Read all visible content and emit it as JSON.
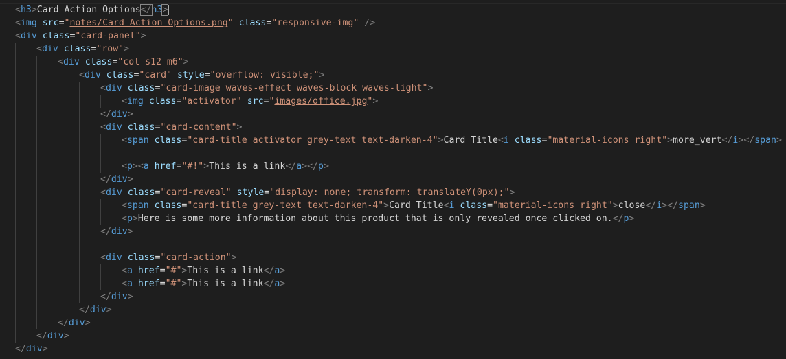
{
  "editor": {
    "lines": [
      {
        "indent": 0,
        "tokens": [
          {
            "c": "p",
            "v": "<"
          },
          {
            "c": "t",
            "v": "h3"
          },
          {
            "c": "p",
            "v": ">"
          },
          {
            "c": "x",
            "v": "Card Action Options"
          },
          {
            "c": "p hl",
            "v": "</"
          },
          {
            "c": "t",
            "v": "h3"
          },
          {
            "c": "p hl",
            "v": ">"
          }
        ]
      },
      {
        "indent": 0,
        "tokens": [
          {
            "c": "p",
            "v": "<"
          },
          {
            "c": "t",
            "v": "img"
          },
          {
            "c": "x",
            "v": " "
          },
          {
            "c": "a",
            "v": "src"
          },
          {
            "c": "x",
            "v": "="
          },
          {
            "c": "s",
            "v": "\""
          },
          {
            "c": "u",
            "v": "notes/Card Action Options.png"
          },
          {
            "c": "s",
            "v": "\""
          },
          {
            "c": "x",
            "v": " "
          },
          {
            "c": "a",
            "v": "class"
          },
          {
            "c": "x",
            "v": "="
          },
          {
            "c": "s",
            "v": "\"responsive-img\""
          },
          {
            "c": "x",
            "v": " "
          },
          {
            "c": "p",
            "v": "/>"
          }
        ]
      },
      {
        "indent": 0,
        "tokens": [
          {
            "c": "p",
            "v": "<"
          },
          {
            "c": "t",
            "v": "div"
          },
          {
            "c": "x",
            "v": " "
          },
          {
            "c": "a",
            "v": "class"
          },
          {
            "c": "x",
            "v": "="
          },
          {
            "c": "s",
            "v": "\"card-panel\""
          },
          {
            "c": "p",
            "v": ">"
          }
        ]
      },
      {
        "indent": 1,
        "tokens": [
          {
            "c": "p",
            "v": "<"
          },
          {
            "c": "t",
            "v": "div"
          },
          {
            "c": "x",
            "v": " "
          },
          {
            "c": "a",
            "v": "class"
          },
          {
            "c": "x",
            "v": "="
          },
          {
            "c": "s",
            "v": "\"row\""
          },
          {
            "c": "p",
            "v": ">"
          }
        ]
      },
      {
        "indent": 2,
        "tokens": [
          {
            "c": "p",
            "v": "<"
          },
          {
            "c": "t",
            "v": "div"
          },
          {
            "c": "x",
            "v": " "
          },
          {
            "c": "a",
            "v": "class"
          },
          {
            "c": "x",
            "v": "="
          },
          {
            "c": "s",
            "v": "\"col s12 m6\""
          },
          {
            "c": "p",
            "v": ">"
          }
        ]
      },
      {
        "indent": 3,
        "tokens": [
          {
            "c": "p",
            "v": "<"
          },
          {
            "c": "t",
            "v": "div"
          },
          {
            "c": "x",
            "v": " "
          },
          {
            "c": "a",
            "v": "class"
          },
          {
            "c": "x",
            "v": "="
          },
          {
            "c": "s",
            "v": "\"card\""
          },
          {
            "c": "x",
            "v": " "
          },
          {
            "c": "a",
            "v": "style"
          },
          {
            "c": "x",
            "v": "="
          },
          {
            "c": "s",
            "v": "\"overflow: visible;\""
          },
          {
            "c": "p",
            "v": ">"
          }
        ]
      },
      {
        "indent": 4,
        "tokens": [
          {
            "c": "p",
            "v": "<"
          },
          {
            "c": "t",
            "v": "div"
          },
          {
            "c": "x",
            "v": " "
          },
          {
            "c": "a",
            "v": "class"
          },
          {
            "c": "x",
            "v": "="
          },
          {
            "c": "s",
            "v": "\"card-image waves-effect waves-block waves-light\""
          },
          {
            "c": "p",
            "v": ">"
          }
        ]
      },
      {
        "indent": 5,
        "tokens": [
          {
            "c": "p",
            "v": "<"
          },
          {
            "c": "t",
            "v": "img"
          },
          {
            "c": "x",
            "v": " "
          },
          {
            "c": "a",
            "v": "class"
          },
          {
            "c": "x",
            "v": "="
          },
          {
            "c": "s",
            "v": "\"activator\""
          },
          {
            "c": "x",
            "v": " "
          },
          {
            "c": "a",
            "v": "src"
          },
          {
            "c": "x",
            "v": "="
          },
          {
            "c": "s",
            "v": "\""
          },
          {
            "c": "u",
            "v": "images/office.jpg"
          },
          {
            "c": "s",
            "v": "\""
          },
          {
            "c": "p",
            "v": ">"
          }
        ]
      },
      {
        "indent": 4,
        "tokens": [
          {
            "c": "p",
            "v": "</"
          },
          {
            "c": "t",
            "v": "div"
          },
          {
            "c": "p",
            "v": ">"
          }
        ]
      },
      {
        "indent": 4,
        "tokens": [
          {
            "c": "p",
            "v": "<"
          },
          {
            "c": "t",
            "v": "div"
          },
          {
            "c": "x",
            "v": " "
          },
          {
            "c": "a",
            "v": "class"
          },
          {
            "c": "x",
            "v": "="
          },
          {
            "c": "s",
            "v": "\"card-content\""
          },
          {
            "c": "p",
            "v": ">"
          }
        ]
      },
      {
        "indent": 5,
        "tokens": [
          {
            "c": "p",
            "v": "<"
          },
          {
            "c": "t",
            "v": "span"
          },
          {
            "c": "x",
            "v": " "
          },
          {
            "c": "a",
            "v": "class"
          },
          {
            "c": "x",
            "v": "="
          },
          {
            "c": "s",
            "v": "\"card-title activator grey-text text-darken-4\""
          },
          {
            "c": "p",
            "v": ">"
          },
          {
            "c": "x",
            "v": "Card Title"
          },
          {
            "c": "p",
            "v": "<"
          },
          {
            "c": "t",
            "v": "i"
          },
          {
            "c": "x",
            "v": " "
          },
          {
            "c": "a",
            "v": "class"
          },
          {
            "c": "x",
            "v": "="
          },
          {
            "c": "s",
            "v": "\"material-icons right\""
          },
          {
            "c": "p",
            "v": ">"
          },
          {
            "c": "x",
            "v": "more_vert"
          },
          {
            "c": "p",
            "v": "</"
          },
          {
            "c": "t",
            "v": "i"
          },
          {
            "c": "p",
            "v": ">"
          },
          {
            "c": "p",
            "v": "</"
          },
          {
            "c": "t",
            "v": "span"
          },
          {
            "c": "p",
            "v": ">"
          }
        ]
      },
      {
        "indent": 5,
        "tokens": []
      },
      {
        "indent": 5,
        "tokens": [
          {
            "c": "p",
            "v": "<"
          },
          {
            "c": "t",
            "v": "p"
          },
          {
            "c": "p",
            "v": ">"
          },
          {
            "c": "p",
            "v": "<"
          },
          {
            "c": "t",
            "v": "a"
          },
          {
            "c": "x",
            "v": " "
          },
          {
            "c": "a",
            "v": "href"
          },
          {
            "c": "x",
            "v": "="
          },
          {
            "c": "s",
            "v": "\"#!\""
          },
          {
            "c": "p",
            "v": ">"
          },
          {
            "c": "x",
            "v": "This is a link"
          },
          {
            "c": "p",
            "v": "</"
          },
          {
            "c": "t",
            "v": "a"
          },
          {
            "c": "p",
            "v": ">"
          },
          {
            "c": "p",
            "v": "</"
          },
          {
            "c": "t",
            "v": "p"
          },
          {
            "c": "p",
            "v": ">"
          }
        ]
      },
      {
        "indent": 4,
        "tokens": [
          {
            "c": "p",
            "v": "</"
          },
          {
            "c": "t",
            "v": "div"
          },
          {
            "c": "p",
            "v": ">"
          }
        ]
      },
      {
        "indent": 4,
        "tokens": [
          {
            "c": "p",
            "v": "<"
          },
          {
            "c": "t",
            "v": "div"
          },
          {
            "c": "x",
            "v": " "
          },
          {
            "c": "a",
            "v": "class"
          },
          {
            "c": "x",
            "v": "="
          },
          {
            "c": "s",
            "v": "\"card-reveal\""
          },
          {
            "c": "x",
            "v": " "
          },
          {
            "c": "a",
            "v": "style"
          },
          {
            "c": "x",
            "v": "="
          },
          {
            "c": "s",
            "v": "\"display: none; transform: translateY(0px);\""
          },
          {
            "c": "p",
            "v": ">"
          }
        ]
      },
      {
        "indent": 5,
        "tokens": [
          {
            "c": "p",
            "v": "<"
          },
          {
            "c": "t",
            "v": "span"
          },
          {
            "c": "x",
            "v": " "
          },
          {
            "c": "a",
            "v": "class"
          },
          {
            "c": "x",
            "v": "="
          },
          {
            "c": "s",
            "v": "\"card-title grey-text text-darken-4\""
          },
          {
            "c": "p",
            "v": ">"
          },
          {
            "c": "x",
            "v": "Card Title"
          },
          {
            "c": "p",
            "v": "<"
          },
          {
            "c": "t",
            "v": "i"
          },
          {
            "c": "x",
            "v": " "
          },
          {
            "c": "a",
            "v": "class"
          },
          {
            "c": "x",
            "v": "="
          },
          {
            "c": "s",
            "v": "\"material-icons right\""
          },
          {
            "c": "p",
            "v": ">"
          },
          {
            "c": "x",
            "v": "close"
          },
          {
            "c": "p",
            "v": "</"
          },
          {
            "c": "t",
            "v": "i"
          },
          {
            "c": "p",
            "v": ">"
          },
          {
            "c": "p",
            "v": "</"
          },
          {
            "c": "t",
            "v": "span"
          },
          {
            "c": "p",
            "v": ">"
          }
        ]
      },
      {
        "indent": 5,
        "tokens": [
          {
            "c": "p",
            "v": "<"
          },
          {
            "c": "t",
            "v": "p"
          },
          {
            "c": "p",
            "v": ">"
          },
          {
            "c": "x",
            "v": "Here is some more information about this product that is only revealed once clicked on."
          },
          {
            "c": "p",
            "v": "</"
          },
          {
            "c": "t",
            "v": "p"
          },
          {
            "c": "p",
            "v": ">"
          }
        ]
      },
      {
        "indent": 4,
        "tokens": [
          {
            "c": "p",
            "v": "</"
          },
          {
            "c": "t",
            "v": "div"
          },
          {
            "c": "p",
            "v": ">"
          }
        ]
      },
      {
        "indent": 4,
        "tokens": []
      },
      {
        "indent": 4,
        "tokens": [
          {
            "c": "p",
            "v": "<"
          },
          {
            "c": "t",
            "v": "div"
          },
          {
            "c": "x",
            "v": " "
          },
          {
            "c": "a",
            "v": "class"
          },
          {
            "c": "x",
            "v": "="
          },
          {
            "c": "s",
            "v": "\"card-action\""
          },
          {
            "c": "p",
            "v": ">"
          }
        ]
      },
      {
        "indent": 5,
        "tokens": [
          {
            "c": "p",
            "v": "<"
          },
          {
            "c": "t",
            "v": "a"
          },
          {
            "c": "x",
            "v": " "
          },
          {
            "c": "a",
            "v": "href"
          },
          {
            "c": "x",
            "v": "="
          },
          {
            "c": "s",
            "v": "\"#\""
          },
          {
            "c": "p",
            "v": ">"
          },
          {
            "c": "x",
            "v": "This is a link"
          },
          {
            "c": "p",
            "v": "</"
          },
          {
            "c": "t",
            "v": "a"
          },
          {
            "c": "p",
            "v": ">"
          }
        ]
      },
      {
        "indent": 5,
        "tokens": [
          {
            "c": "p",
            "v": "<"
          },
          {
            "c": "t",
            "v": "a"
          },
          {
            "c": "x",
            "v": " "
          },
          {
            "c": "a",
            "v": "href"
          },
          {
            "c": "x",
            "v": "="
          },
          {
            "c": "s",
            "v": "\"#\""
          },
          {
            "c": "p",
            "v": ">"
          },
          {
            "c": "x",
            "v": "This is a link"
          },
          {
            "c": "p",
            "v": "</"
          },
          {
            "c": "t",
            "v": "a"
          },
          {
            "c": "p",
            "v": ">"
          }
        ]
      },
      {
        "indent": 4,
        "tokens": [
          {
            "c": "p",
            "v": "</"
          },
          {
            "c": "t",
            "v": "div"
          },
          {
            "c": "p",
            "v": ">"
          }
        ]
      },
      {
        "indent": 3,
        "tokens": [
          {
            "c": "p",
            "v": "</"
          },
          {
            "c": "t",
            "v": "div"
          },
          {
            "c": "p",
            "v": ">"
          }
        ]
      },
      {
        "indent": 2,
        "tokens": [
          {
            "c": "p",
            "v": "</"
          },
          {
            "c": "t",
            "v": "div"
          },
          {
            "c": "p",
            "v": ">"
          }
        ]
      },
      {
        "indent": 1,
        "tokens": [
          {
            "c": "p",
            "v": "</"
          },
          {
            "c": "t",
            "v": "div"
          },
          {
            "c": "p",
            "v": ">"
          }
        ]
      },
      {
        "indent": 0,
        "tokens": [
          {
            "c": "p",
            "v": "</"
          },
          {
            "c": "t",
            "v": "div"
          },
          {
            "c": "p",
            "v": ">"
          }
        ]
      }
    ],
    "colors": {
      "background": "#1e1e1e",
      "tag": "#569cd6",
      "punctuation": "#808080",
      "attribute": "#9cdcfe",
      "string": "#ce9178",
      "text": "#d4d4d4",
      "indent_guide": "#404040"
    }
  }
}
